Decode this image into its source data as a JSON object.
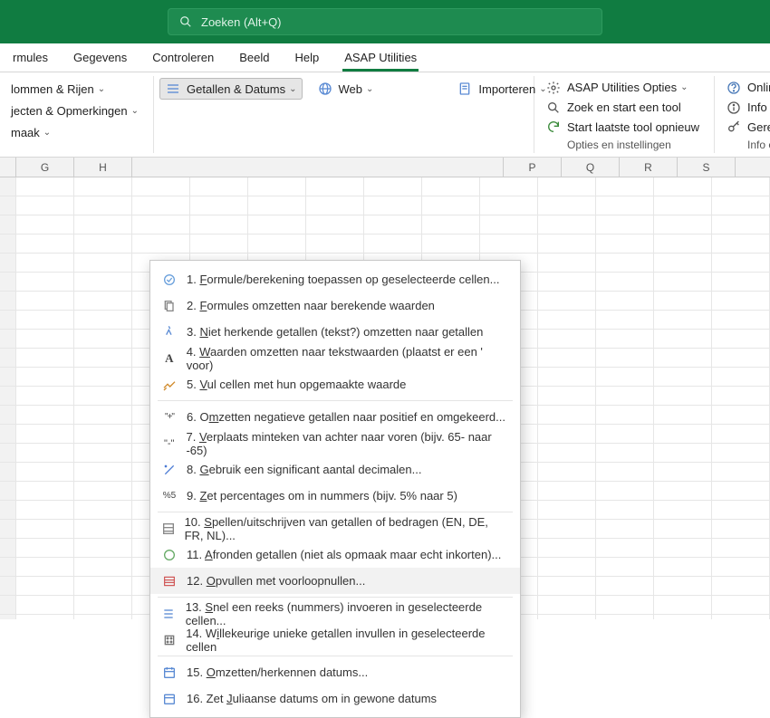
{
  "search": {
    "placeholder": "Zoeken (Alt+Q)"
  },
  "tabs": {
    "formules": "rmules",
    "gegevens": "Gegevens",
    "controleren": "Controleren",
    "beeld": "Beeld",
    "help": "Help",
    "asap": "ASAP Utilities"
  },
  "ribbon": {
    "group1": {
      "item1": "lommen & Rijen",
      "item2": "jecten & Opmerkingen",
      "item3": "maak"
    },
    "group2": {
      "item1": "Getallen & Datums",
      "item2": "Web",
      "item3": "Importeren"
    },
    "group3": {
      "opties": "ASAP Utilities Opties",
      "zoek": "Zoek en start een tool",
      "laatste": "Start laatste tool opnieuw",
      "sub": "Opties en instellingen"
    },
    "group4": {
      "faq": "Online FA",
      "info": "Info",
      "reg": "Geregistre",
      "sub": "Info en"
    }
  },
  "columns": [
    "G",
    "H",
    "",
    "",
    "",
    "",
    "",
    "P",
    "Q",
    "R",
    "S"
  ],
  "menu": {
    "items": [
      {
        "idx": 1,
        "accel": "F",
        "pre": "1. ",
        "rest": "ormule/berekening toepassen op geselecteerde cellen..."
      },
      {
        "idx": 2,
        "accel": "F",
        "pre": "2. ",
        "rest": "ormules omzetten naar berekende waarden"
      },
      {
        "idx": 3,
        "accel": "N",
        "pre": "3. ",
        "rest": "iet herkende getallen (tekst?) omzetten naar getallen"
      },
      {
        "idx": 4,
        "accel": "W",
        "pre": "4. ",
        "rest": "aarden omzetten naar tekstwaarden (plaatst er een ' voor)"
      },
      {
        "idx": 5,
        "accel": "V",
        "pre": "5. ",
        "rest": "ul cellen met hun opgemaakte waarde"
      },
      {
        "idx": 6,
        "accel": "m",
        "pre": "6. O",
        "rest": "zetten negatieve getallen naar positief en omgekeerd..."
      },
      {
        "idx": 7,
        "accel": "V",
        "pre": "7. ",
        "rest": "erplaats minteken van achter naar voren (bijv. 65- naar -65)"
      },
      {
        "idx": 8,
        "accel": "G",
        "pre": "8. ",
        "rest": "ebruik een significant aantal decimalen..."
      },
      {
        "idx": 9,
        "accel": "Z",
        "pre": "9. ",
        "rest": "et percentages om in nummers (bijv. 5% naar 5)"
      },
      {
        "idx": 10,
        "accel": "S",
        "pre": "10. ",
        "rest": "pellen/uitschrijven van getallen of bedragen (EN, DE, FR, NL)..."
      },
      {
        "idx": 11,
        "accel": "A",
        "pre": "11. ",
        "rest": "fronden getallen (niet als opmaak maar echt inkorten)..."
      },
      {
        "idx": 12,
        "accel": "O",
        "pre": "12. ",
        "rest": "pvullen met voorloopnullen..."
      },
      {
        "idx": 13,
        "accel": "S",
        "pre": "13. ",
        "rest": "nel een reeks (nummers) invoeren in geselecteerde cellen..."
      },
      {
        "idx": 14,
        "accel": "i",
        "pre": "14. W",
        "rest": "llekeurige unieke getallen invullen in geselecteerde cellen"
      },
      {
        "idx": 15,
        "accel": "O",
        "pre": "15. ",
        "rest": "mzetten/herkennen datums..."
      },
      {
        "idx": 16,
        "accel": "J",
        "pre": "16. Zet ",
        "rest": "uliaanse datums om in gewone datums"
      }
    ],
    "separators_after": [
      5,
      9,
      12,
      14
    ],
    "hovered": 12
  }
}
